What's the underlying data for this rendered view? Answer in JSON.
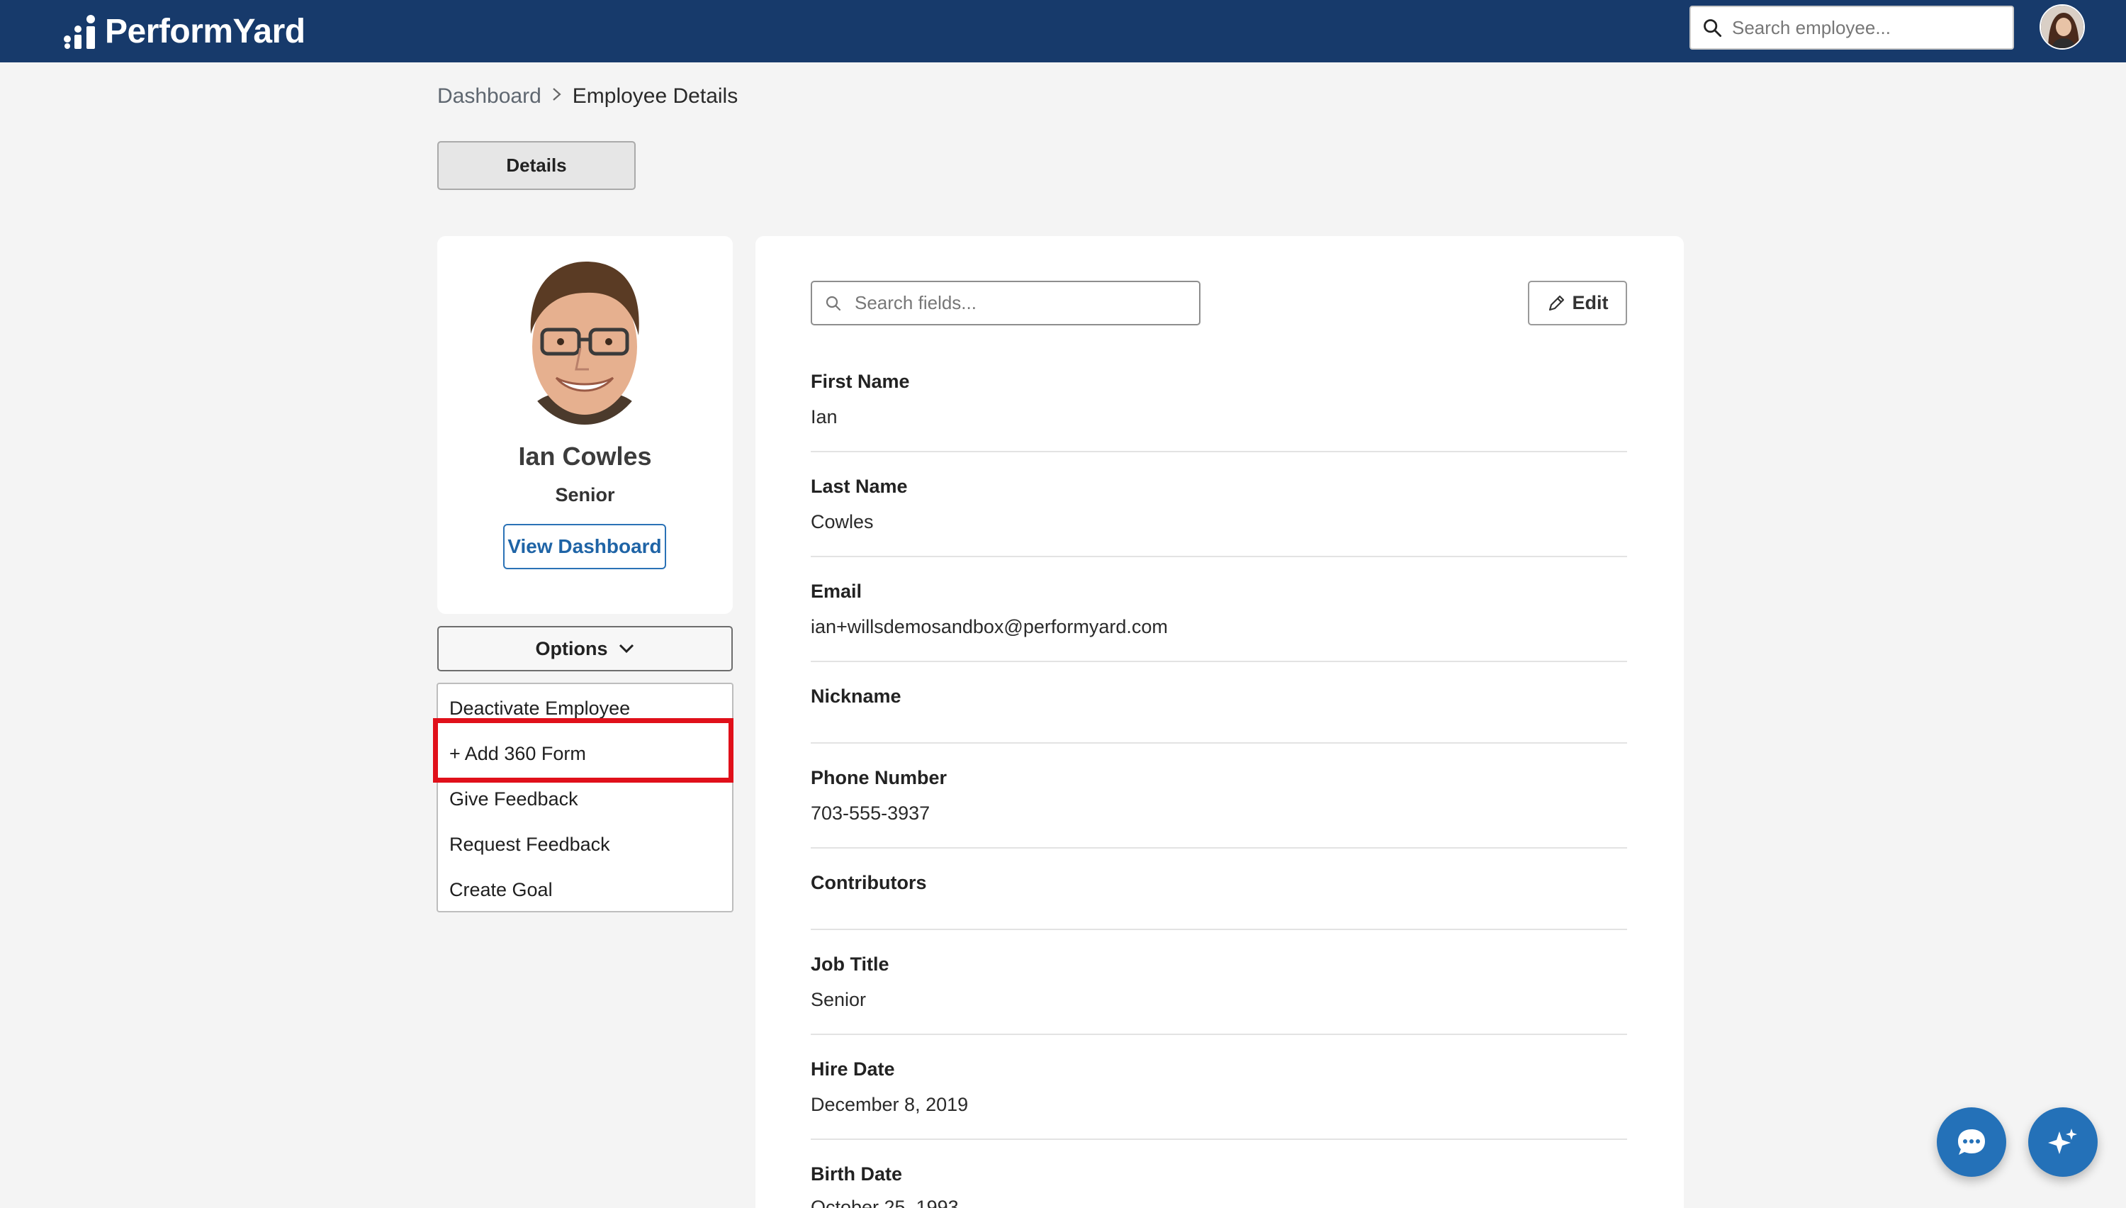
{
  "app": {
    "brand": "PerformYard",
    "top_search_placeholder": "Search employee..."
  },
  "breadcrumb": {
    "parent": "Dashboard",
    "current": "Employee Details"
  },
  "tabs": {
    "details": "Details"
  },
  "profile": {
    "name": "Ian Cowles",
    "title": "Senior",
    "view_dashboard": "View Dashboard"
  },
  "options": {
    "label": "Options",
    "items": [
      "Deactivate Employee",
      "+ Add 360 Form",
      "Give Feedback",
      "Request Feedback",
      "Create Goal"
    ]
  },
  "fields_panel": {
    "search_placeholder": "Search fields...",
    "edit_label": "Edit",
    "fields": [
      {
        "label": "First Name",
        "value": "Ian"
      },
      {
        "label": "Last Name",
        "value": "Cowles"
      },
      {
        "label": "Email",
        "value": "ian+willsdemosandbox@performyard.com"
      },
      {
        "label": "Nickname",
        "value": ""
      },
      {
        "label": "Phone Number",
        "value": "703-555-3937"
      },
      {
        "label": "Contributors",
        "value": ""
      },
      {
        "label": "Job Title",
        "value": "Senior"
      },
      {
        "label": "Hire Date",
        "value": "December 8, 2019"
      },
      {
        "label": "Birth Date",
        "value": "October 25, 1993"
      }
    ]
  },
  "colors": {
    "topbar": "#173a6b",
    "accent": "#2471b8",
    "highlight": "#e0101a"
  }
}
